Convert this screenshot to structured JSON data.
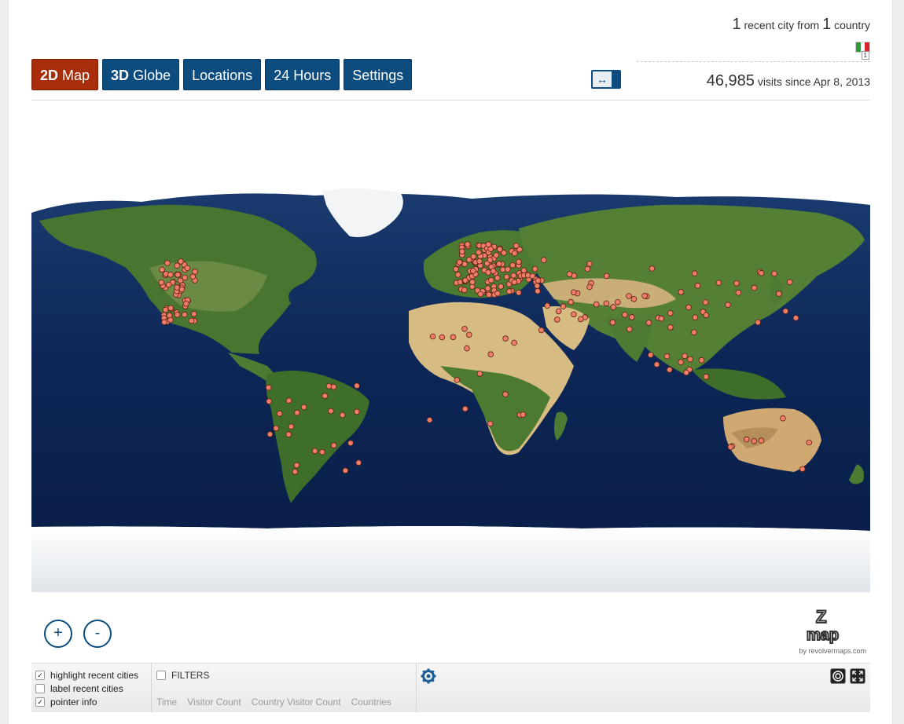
{
  "header": {
    "recent_count": "1",
    "recent_text_a": "recent city from",
    "country_count": "1",
    "recent_text_b": "country",
    "flag_count": "1",
    "visits_count": "46,985",
    "visits_text": "visits since Apr 8, 2013"
  },
  "tabs": [
    {
      "bold": "2D",
      "label": "Map",
      "active": true
    },
    {
      "bold": "3D",
      "label": "Globe",
      "active": false
    },
    {
      "bold": "",
      "label": "Locations",
      "active": false
    },
    {
      "bold": "",
      "label": "24 Hours",
      "active": false
    },
    {
      "bold": "",
      "label": "Settings",
      "active": false
    }
  ],
  "swap_icon": "↔",
  "zoom": {
    "plus": "+",
    "minus": "-"
  },
  "logo_by": "by revolvermaps.com",
  "options": {
    "highlight": {
      "label": "highlight recent cities",
      "checked": true
    },
    "label": {
      "label": "label recent cities",
      "checked": false
    },
    "pointer": {
      "label": "pointer info",
      "checked": true
    }
  },
  "filters": {
    "label": "FILTERS",
    "checked": false,
    "columns": [
      "Time",
      "Visitor Count",
      "Country Visitor Count",
      "Countries"
    ]
  },
  "colors": {
    "primary": "#0c4c7f",
    "active": "#a82d0b",
    "ocean": "#0e2a5c",
    "land": "#4f7a33",
    "desert": "#d9bf86",
    "ice": "#eef1f3",
    "marker": "#f07d68"
  },
  "icons": [
    "arrows-horizontal-icon",
    "zoom-in-icon",
    "zoom-out-icon",
    "gear-icon",
    "target-icon",
    "fullscreen-icon",
    "flag-italy-icon"
  ]
}
